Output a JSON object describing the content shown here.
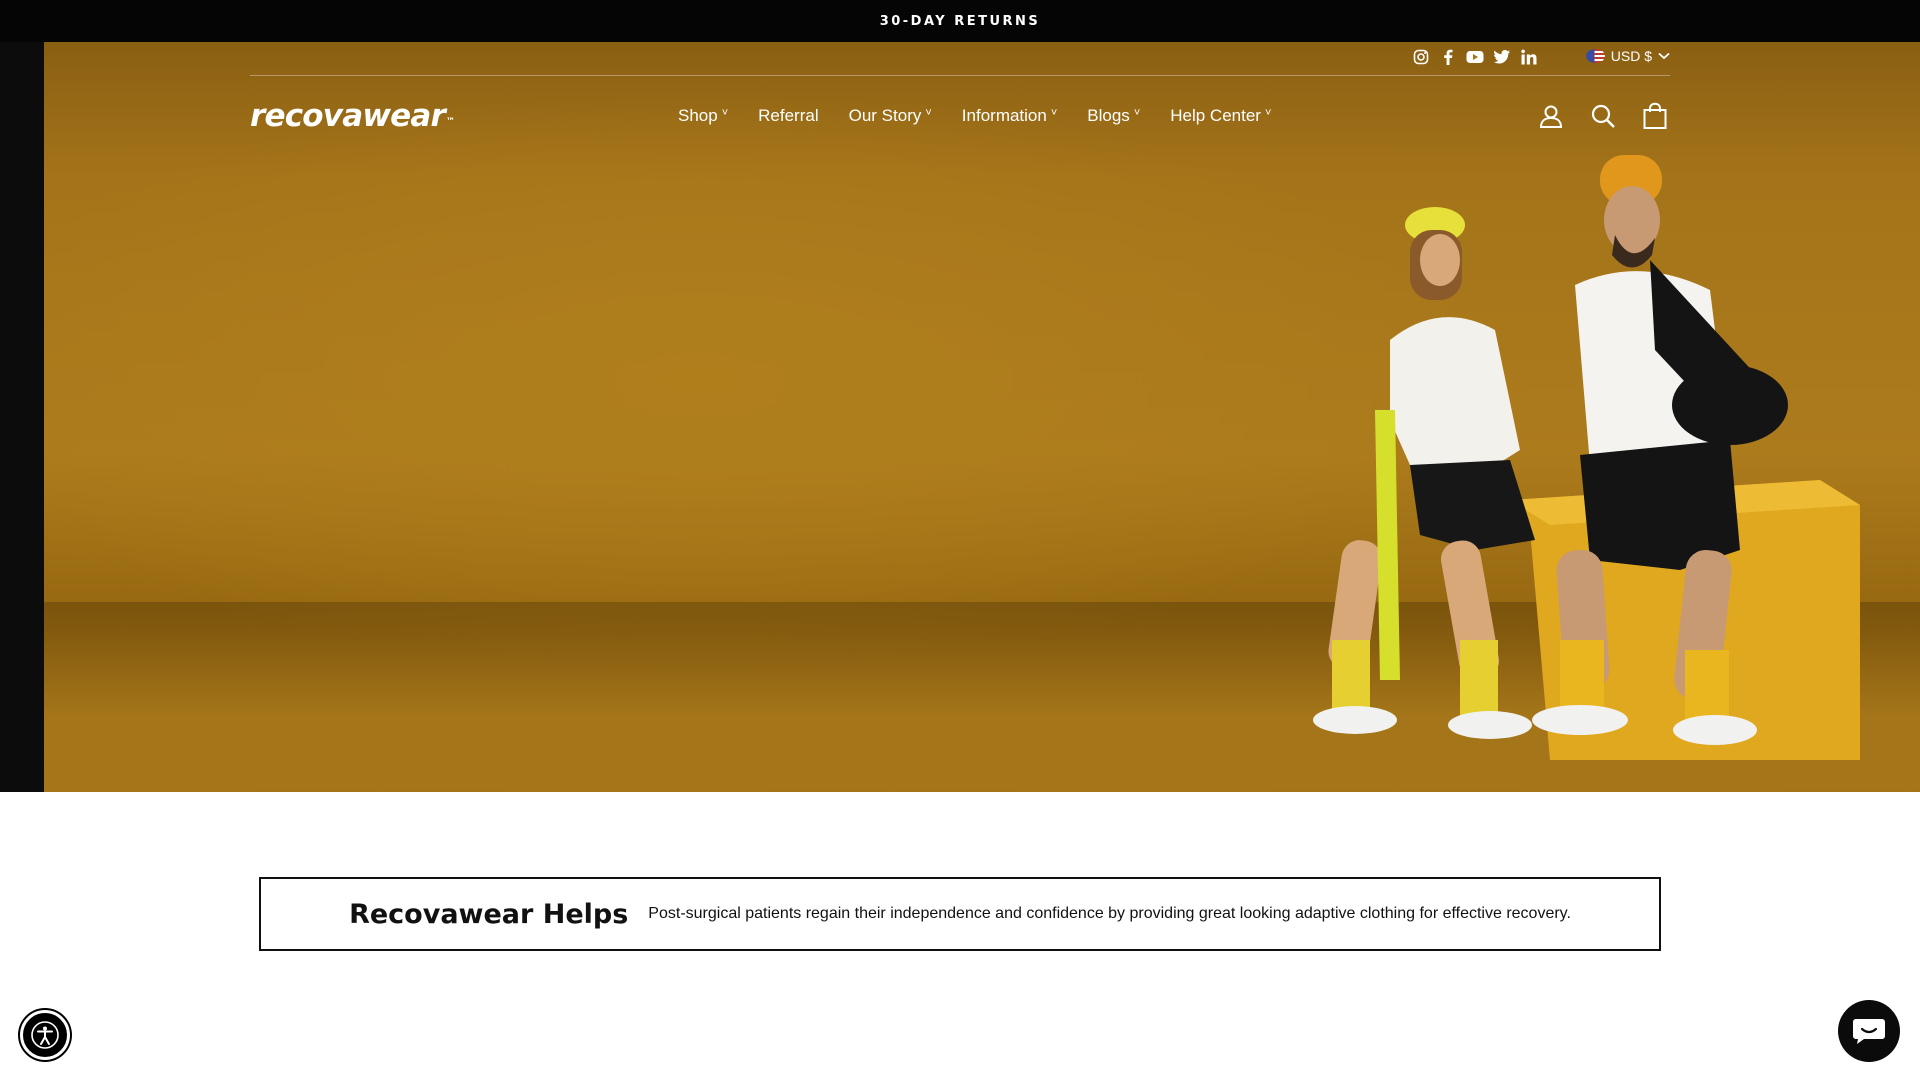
{
  "announcement": {
    "text": "30-DAY RETURNS"
  },
  "header": {
    "logo_text": "recovawear",
    "logo_mark": "™",
    "socials": [
      "instagram-icon",
      "facebook-icon",
      "youtube-icon",
      "twitter-icon",
      "linkedin-icon"
    ],
    "currency": {
      "flag": "us-flag-icon",
      "label": "USD $"
    },
    "nav": [
      {
        "label": "Shop",
        "dropdown": true
      },
      {
        "label": "Referral",
        "dropdown": false
      },
      {
        "label": "Our Story",
        "dropdown": true
      },
      {
        "label": "Information",
        "dropdown": true
      },
      {
        "label": "Blogs",
        "dropdown": true
      },
      {
        "label": "Help Center",
        "dropdown": true
      }
    ],
    "caret": "˅",
    "icons": [
      "account-icon",
      "search-icon",
      "cart-icon"
    ]
  },
  "helps": {
    "title": "Recovawear Helps",
    "text": "Post-surgical patients regain their independence and confidence by providing great looking adaptive clothing for effective recovery."
  },
  "colors": {
    "hero_bg": "#a4741a",
    "announcement_bg": "#050505",
    "chat_bg": "#0b0b0b",
    "text": "#111111"
  }
}
